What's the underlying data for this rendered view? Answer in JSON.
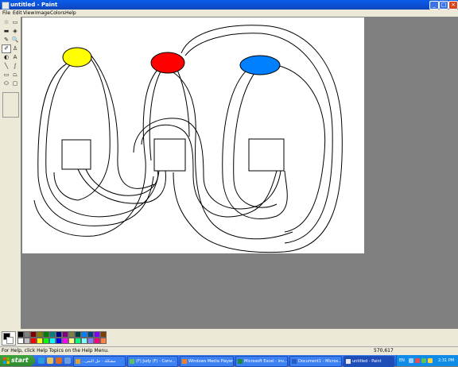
{
  "window": {
    "title": "untitled - Paint",
    "controls": [
      "_",
      "□",
      "×"
    ]
  },
  "menu": [
    "File",
    "Edit",
    "View",
    "Image",
    "Colors",
    "Help"
  ],
  "tools": [
    {
      "name": "free-form-select",
      "glyph": "☆"
    },
    {
      "name": "select",
      "glyph": "▭"
    },
    {
      "name": "eraser",
      "glyph": "▬"
    },
    {
      "name": "fill",
      "glyph": "◈"
    },
    {
      "name": "pick-color",
      "glyph": "✎"
    },
    {
      "name": "magnifier",
      "glyph": "🔍"
    },
    {
      "name": "pencil",
      "glyph": "✐"
    },
    {
      "name": "brush",
      "glyph": "♙"
    },
    {
      "name": "airbrush",
      "glyph": "◐"
    },
    {
      "name": "text",
      "glyph": "A"
    },
    {
      "name": "line",
      "glyph": "╲"
    },
    {
      "name": "curve",
      "glyph": "∫"
    },
    {
      "name": "rectangle",
      "glyph": "▭"
    },
    {
      "name": "polygon",
      "glyph": "⏢"
    },
    {
      "name": "ellipse",
      "glyph": "⬭"
    },
    {
      "name": "rounded-rectangle",
      "glyph": "▢"
    }
  ],
  "drawing": {
    "ellipses": [
      {
        "name": "yellow-ellipse",
        "color": "#ffff00"
      },
      {
        "name": "red-ellipse",
        "color": "#ff0000"
      },
      {
        "name": "blue-ellipse",
        "color": "#0080ff"
      }
    ]
  },
  "palette": {
    "foreground": "#000000",
    "background": "#ffffff",
    "row1": [
      "#000000",
      "#808080",
      "#800000",
      "#808000",
      "#008000",
      "#008080",
      "#000080",
      "#800080",
      "#808040",
      "#004040",
      "#0080ff",
      "#004080",
      "#8000ff",
      "#804000"
    ],
    "row2": [
      "#ffffff",
      "#c0c0c0",
      "#ff0000",
      "#ffff00",
      "#00ff00",
      "#00ffff",
      "#0000ff",
      "#ff00ff",
      "#ffff80",
      "#00ff80",
      "#80ffff",
      "#8080ff",
      "#ff0080",
      "#ff8040"
    ]
  },
  "status": {
    "help": "For Help, click Help Topics on the Help Menu.",
    "coords": "570,617"
  },
  "taskbar": {
    "start": "start",
    "items": [
      {
        "label": "...مشكلة - حل التمر",
        "active": false
      },
      {
        "label": "(F) Judy (F) - Conv...",
        "active": false
      },
      {
        "label": "Windows Media Player",
        "active": false
      },
      {
        "label": "Microsoft Excel - inv...",
        "active": false
      },
      {
        "label": "Document1 - Micros...",
        "active": false
      },
      {
        "label": "untitled - Paint",
        "active": true
      }
    ],
    "language": "EN",
    "clock": "2:31 PM"
  }
}
